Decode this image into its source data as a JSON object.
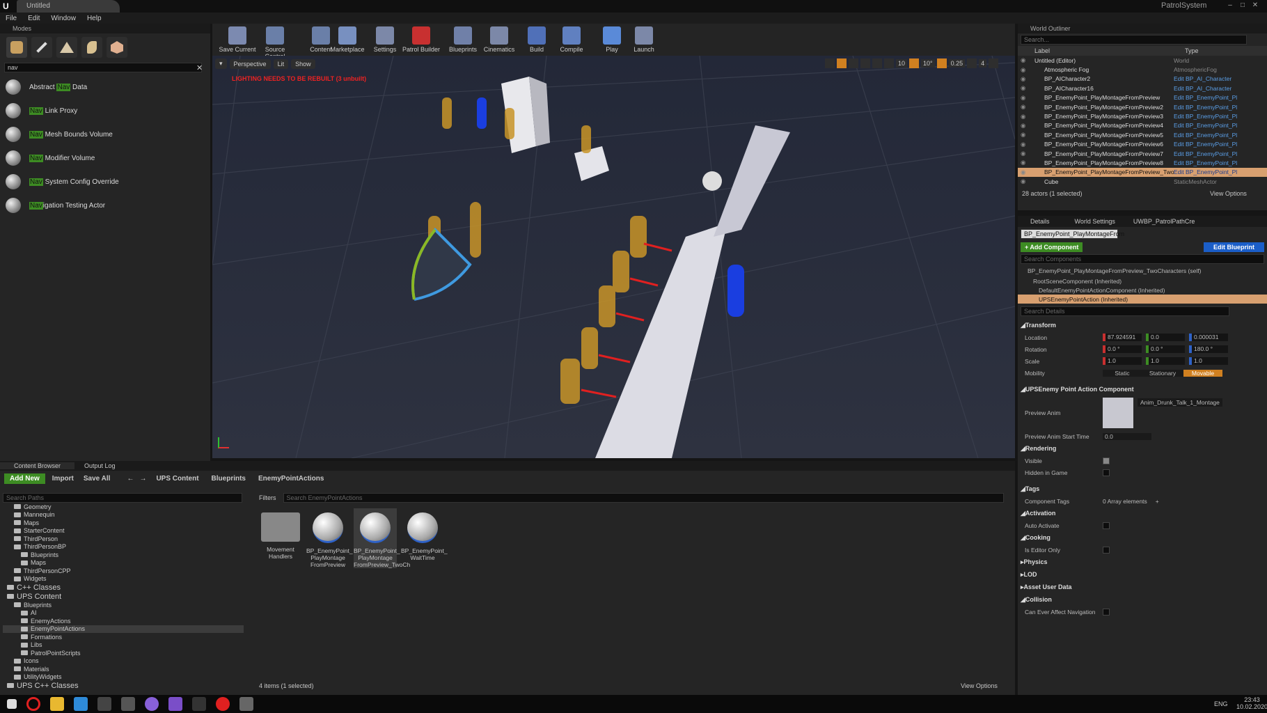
{
  "title_bar": {
    "doc_tab": "Untitled",
    "project": "PatrolSystem"
  },
  "menu": [
    "File",
    "Edit",
    "Window",
    "Help"
  ],
  "modes": {
    "tab": "Modes",
    "search": "nav",
    "items": [
      {
        "pre": "Abstract ",
        "hl": "Nav",
        "post": " Data"
      },
      {
        "pre": "",
        "hl": "Nav",
        "post": " Link Proxy"
      },
      {
        "pre": "",
        "hl": "Nav",
        "post": " Mesh Bounds Volume"
      },
      {
        "pre": "",
        "hl": "Nav",
        "post": " Modifier Volume"
      },
      {
        "pre": "",
        "hl": "Nav",
        "post": " System Config Override"
      },
      {
        "pre": "",
        "hl": "Nav",
        "post": "igation Testing Actor"
      }
    ]
  },
  "toolbar": [
    "Save Current",
    "Source Control",
    "Content",
    "Marketplace",
    "Settings",
    "Patrol Builder",
    "Blueprints",
    "Cinematics",
    "Build",
    "Compile",
    "Play",
    "Launch"
  ],
  "viewport": {
    "perspective": "Perspective",
    "lit": "Lit",
    "show": "Show",
    "warning": "LIGHTING NEEDS TO BE REBUILT (3 unbuilt)",
    "snap_grid": "10",
    "snap_rot": "10°",
    "snap_scale": "0.25",
    "cam_speed": "4"
  },
  "outliner": {
    "tab": "World Outliner",
    "search": "Search...",
    "col_label": "Label",
    "col_type": "Type",
    "rows": [
      {
        "label": "Untitled (Editor)",
        "type": "World"
      },
      {
        "label": "Atmospheric Fog",
        "type": "AtmosphericFog"
      },
      {
        "label": "BP_AICharacter2",
        "type": "Edit BP_AI_Character"
      },
      {
        "label": "BP_AICharacter16",
        "type": "Edit BP_AI_Character"
      },
      {
        "label": "BP_EnemyPoint_PlayMontageFromPreview",
        "type": "Edit BP_EnemyPoint_Pl"
      },
      {
        "label": "BP_EnemyPoint_PlayMontageFromPreview2",
        "type": "Edit BP_EnemyPoint_Pl"
      },
      {
        "label": "BP_EnemyPoint_PlayMontageFromPreview3",
        "type": "Edit BP_EnemyPoint_Pl"
      },
      {
        "label": "BP_EnemyPoint_PlayMontageFromPreview4",
        "type": "Edit BP_EnemyPoint_Pl"
      },
      {
        "label": "BP_EnemyPoint_PlayMontageFromPreview5",
        "type": "Edit BP_EnemyPoint_Pl"
      },
      {
        "label": "BP_EnemyPoint_PlayMontageFromPreview6",
        "type": "Edit BP_EnemyPoint_Pl"
      },
      {
        "label": "BP_EnemyPoint_PlayMontageFromPreview7",
        "type": "Edit BP_EnemyPoint_Pl"
      },
      {
        "label": "BP_EnemyPoint_PlayMontageFromPreview8",
        "type": "Edit BP_EnemyPoint_Pl"
      },
      {
        "label": "BP_EnemyPoint_PlayMontageFromPreview_TwoCh",
        "type": "Edit BP_EnemyPoint_Pl"
      },
      {
        "label": "Cube",
        "type": "StaticMeshActor"
      }
    ],
    "count": "28 actors (1 selected)",
    "view_options": "View Options"
  },
  "details": {
    "tab": "Details",
    "tab2": "World Settings",
    "tab3": "UWBP_PatrolPathCre",
    "actor": "BP_EnemyPoint_PlayMontageFrom",
    "add_component": "+ Add Component",
    "edit_blueprint": "Edit Blueprint",
    "search_components": "Search Components",
    "self": "BP_EnemyPoint_PlayMontageFromPreview_TwoCharacters (self)",
    "components": [
      "RootSceneComponent (Inherited)",
      "DefaultEnemyPointActionComponent (Inherited)",
      "UPSEnemyPointAction (Inherited)"
    ],
    "search_details": "Search Details",
    "transform": "Transform",
    "location": "Location",
    "loc": [
      "87.924591",
      "0.0",
      "0.000031"
    ],
    "rotation": "Rotation",
    "rot": [
      "0.0 °",
      "0.0 °",
      "180.0 °"
    ],
    "scale": "Scale",
    "scl": [
      "1.0",
      "1.0",
      "1.0"
    ],
    "mobility": "Mobility",
    "mob": [
      "Static",
      "Stationary",
      "Movable"
    ],
    "ups_section": "UPSEnemy Point Action Component",
    "preview_anim": "Preview Anim",
    "anim_name": "Anim_Drunk_Talk_1_Montage",
    "preview_start": "Preview Anim Start Time",
    "preview_start_val": "0.0",
    "rendering": "Rendering",
    "visible": "Visible",
    "hidden": "Hidden in Game",
    "tags": "Tags",
    "component_tags": "Component Tags",
    "array": "0 Array elements",
    "activation": "Activation",
    "auto_activate": "Auto Activate",
    "cooking": "Cooking",
    "editor_only": "Is Editor Only",
    "physics": "Physics",
    "lod": "LOD",
    "asset_user_data": "Asset User Data",
    "collision": "Collision",
    "can_affect_nav": "Can Ever Affect Navigation"
  },
  "content": {
    "tab": "Content Browser",
    "tab2": "Output Log",
    "add_new": "Add New",
    "import": "Import",
    "save_all": "Save All",
    "path": [
      "UPS Content",
      "Blueprints",
      "EnemyPointActions"
    ],
    "search_paths": "Search Paths",
    "filters": "Filters",
    "search_assets": "Search EnemyPointActions",
    "tree": [
      {
        "t": "Geometry",
        "d": 1
      },
      {
        "t": "Mannequin",
        "d": 1
      },
      {
        "t": "Maps",
        "d": 1
      },
      {
        "t": "StarterContent",
        "d": 1
      },
      {
        "t": "ThirdPerson",
        "d": 1
      },
      {
        "t": "ThirdPersonBP",
        "d": 1
      },
      {
        "t": "Blueprints",
        "d": 2
      },
      {
        "t": "Maps",
        "d": 2
      },
      {
        "t": "ThirdPersonCPP",
        "d": 1
      },
      {
        "t": "Widgets",
        "d": 1
      },
      {
        "t": "C++ Classes",
        "d": 0
      },
      {
        "t": "UPS Content",
        "d": 0
      },
      {
        "t": "Blueprints",
        "d": 1
      },
      {
        "t": "AI",
        "d": 2
      },
      {
        "t": "EnemyActions",
        "d": 2
      },
      {
        "t": "EnemyPointActions",
        "d": 2
      },
      {
        "t": "Formations",
        "d": 2
      },
      {
        "t": "Libs",
        "d": 2
      },
      {
        "t": "PatrolPointScripts",
        "d": 2
      },
      {
        "t": "Icons",
        "d": 1
      },
      {
        "t": "Materials",
        "d": 1
      },
      {
        "t": "UtilityWidgets",
        "d": 1
      },
      {
        "t": "UPS C++ Classes",
        "d": 0
      }
    ],
    "assets": [
      [
        "Movement",
        "Handlers"
      ],
      [
        "BP_EnemyPoint_",
        "PlayMontage",
        "FromPreview"
      ],
      [
        "BP_EnemyPoint_",
        "PlayMontage",
        "FromPreview_TwoCh"
      ],
      [
        "BP_EnemyPoint_",
        "WaitTime",
        ""
      ]
    ],
    "items_count": "4 items (1 selected)",
    "view_options": "View Options"
  },
  "taskbar": {
    "lang": "ENG",
    "time": "23:43",
    "date": "10.02.2020"
  }
}
